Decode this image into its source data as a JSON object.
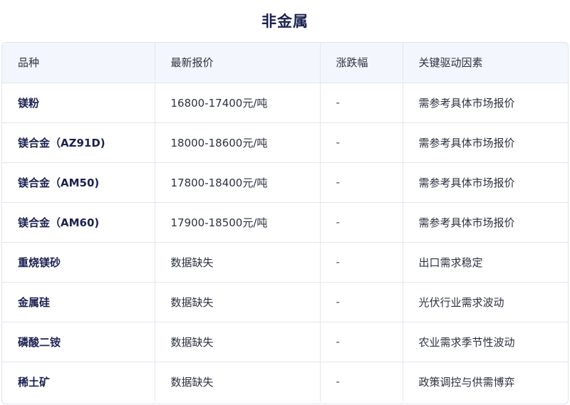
{
  "title": "非金属",
  "headers": [
    "品种",
    "最新报价",
    "涨跌幅",
    "关键驱动因素"
  ],
  "rows": [
    {
      "name": "镁粉",
      "price": "16800-17400元/吨",
      "change": "-",
      "driver": "需参考具体市场报价"
    },
    {
      "name": "镁合金（AZ91D)",
      "price": "18000-18600元/吨",
      "change": "-",
      "driver": "需参考具体市场报价"
    },
    {
      "name": "镁合金（AM50)",
      "price": "17800-18400元/吨",
      "change": "-",
      "driver": "需参考具体市场报价"
    },
    {
      "name": "镁合金（AM60)",
      "price": "17900-18500元/吨",
      "change": "-",
      "driver": "需参考具体市场报价"
    },
    {
      "name": "重烧镁砂",
      "price": "数据缺失",
      "change": "-",
      "driver": "出口需求稳定"
    },
    {
      "name": "金属硅",
      "price": "数据缺失",
      "change": "-",
      "driver": "光伏行业需求波动"
    },
    {
      "name": "磷酸二铵",
      "price": "数据缺失",
      "change": "-",
      "driver": "农业需求季节性波动"
    },
    {
      "name": "稀土矿",
      "price": "数据缺失",
      "change": "-",
      "driver": "政策调控与供需博弈"
    }
  ]
}
